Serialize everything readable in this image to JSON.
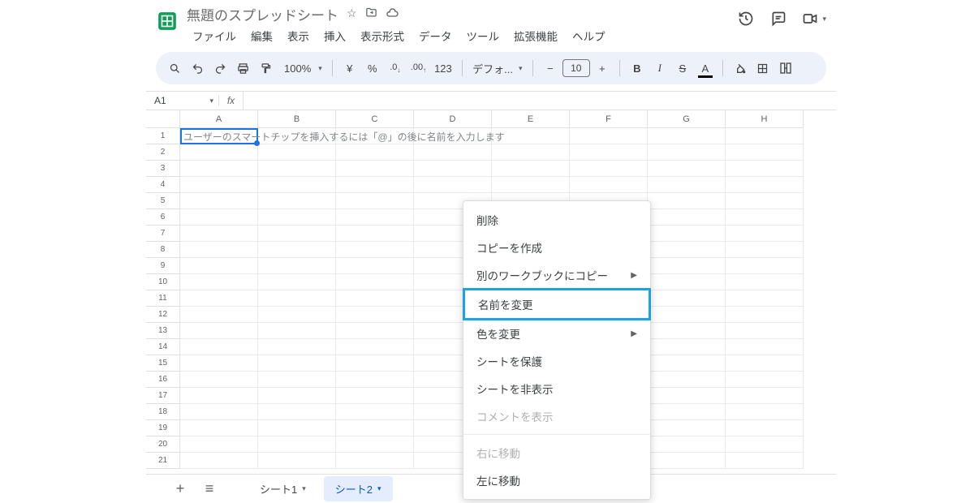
{
  "header": {
    "doc_title": "無題のスプレッドシート",
    "menus": [
      "ファイル",
      "編集",
      "表示",
      "挿入",
      "表示形式",
      "データ",
      "ツール",
      "拡張機能",
      "ヘルプ"
    ]
  },
  "toolbar": {
    "zoom": "100%",
    "currency": "¥",
    "percent": "%",
    "dec_dec": ".0",
    "dec_inc": ".00",
    "num_fmt": "123",
    "font_name": "デフォ...",
    "font_size": "10",
    "bold": "B",
    "italic": "I"
  },
  "fxbar": {
    "name_box": "A1",
    "fx": "fx"
  },
  "grid": {
    "columns": [
      "A",
      "B",
      "C",
      "D",
      "E",
      "F",
      "G",
      "H"
    ],
    "row_count": 21,
    "placeholder": "ユーザーのスマートチップを挿入するには「@」の後に名前を入力します"
  },
  "sheets": {
    "tab1": "シート1",
    "tab2": "シート2"
  },
  "ctx": {
    "delete": "削除",
    "copy": "コピーを作成",
    "copy_to_wb": "別のワークブックにコピー",
    "rename": "名前を変更",
    "change_color": "色を変更",
    "protect": "シートを保護",
    "hide": "シートを非表示",
    "show_comments": "コメントを表示",
    "move_right": "右に移動",
    "move_left": "左に移動"
  }
}
